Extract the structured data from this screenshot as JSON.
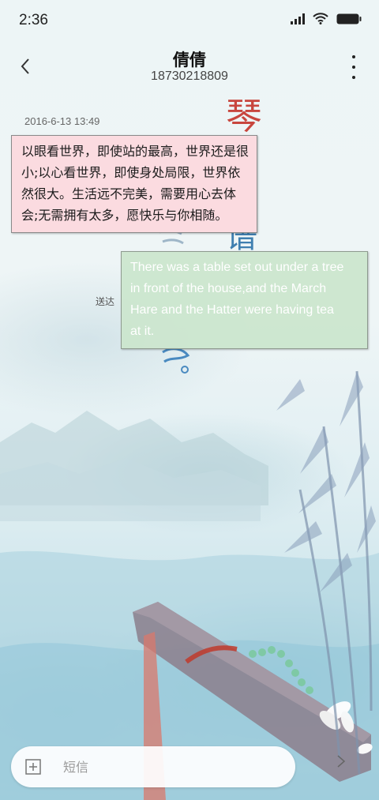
{
  "status_bar": {
    "time": "2:36",
    "icons": [
      "signal-icon",
      "wifi-icon",
      "battery-icon"
    ]
  },
  "header": {
    "contact_name": "倩倩",
    "contact_number": "18730218809",
    "back_icon": "chevron-left-icon",
    "more_icon": "more-vertical-icon"
  },
  "conversation": {
    "timestamp": "2016-6-13 13:49",
    "messages": [
      {
        "direction": "incoming",
        "lines": [
          "以眼看世界，即使站的最高，世界还是很",
          "小;以心看世界，即使身处局限，世界依",
          "然很大。生活远不完美，需要用心去体",
          "会;无需拥有太多，愿快乐与你相随。"
        ]
      },
      {
        "direction": "outgoing",
        "lines": [
          "There was a table set out under a tree",
          "in front of the house,and the March",
          "Hare and the Hatter were having tea",
          "at it."
        ],
        "status": "送达"
      }
    ]
  },
  "composer": {
    "placeholder": "短信",
    "attach_icon": "add-attachment-icon",
    "send_icon": "send-arrow-icon"
  },
  "background": {
    "calligraphy": [
      "琴",
      "谱"
    ],
    "colors": {
      "incoming_bubble": "#fbdbe0",
      "outgoing_bubble": "#cbe6ce",
      "outgoing_text": "#ffffff",
      "seal_red": "#c8463e",
      "ink_blue": "#3f7fb0"
    }
  }
}
